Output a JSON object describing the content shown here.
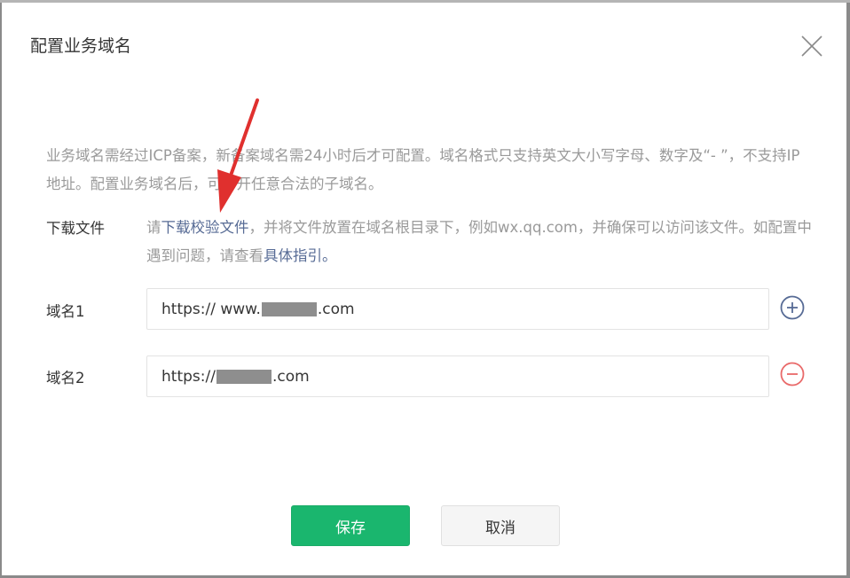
{
  "dialog": {
    "title": "配置业务域名",
    "description": "业务域名需经过ICP备案，新备案域名需24小时后才可配置。域名格式只支持英文大小写字母、数字及“- ”，不支持IP地址。配置业务域名后，可打开任意合法的子域名。",
    "download": {
      "label": "下载文件",
      "text_prefix": "请",
      "link_download": "下载校验文件",
      "text_middle": "，并将文件放置在域名根目录下，例如wx.qq.com，并确保可以访问该文件。如配置中遇到问题，请查看",
      "link_guide": "具体指引",
      "text_suffix": "。"
    },
    "domains": [
      {
        "label": "域名1",
        "prefix": "https:// www.",
        "suffix": ".com"
      },
      {
        "label": "域名2",
        "prefix": "https:// ",
        "suffix": ".com"
      }
    ],
    "buttons": {
      "save": "保存",
      "cancel": "取消"
    },
    "icons": {
      "close": "close-icon",
      "add": "plus-circle-icon",
      "remove": "minus-circle-icon",
      "annotation": "red-arrow-icon"
    },
    "colors": {
      "primary": "#07b062",
      "link": "#576b95",
      "danger": "#e96a6a",
      "arrow": "#e0302e"
    }
  }
}
